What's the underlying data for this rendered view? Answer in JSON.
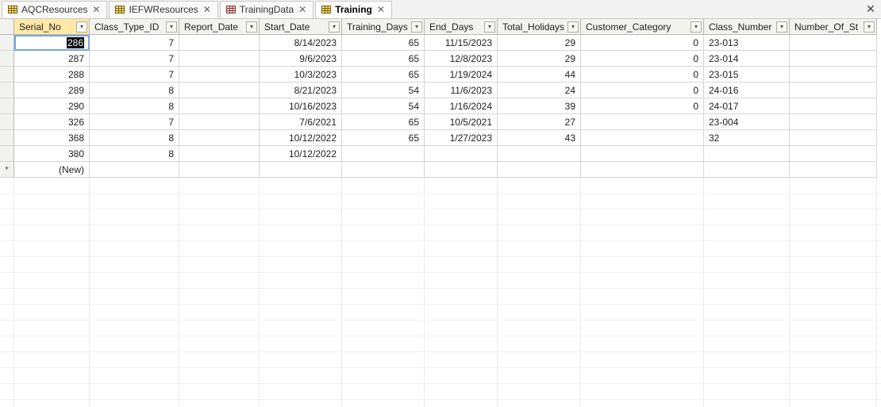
{
  "tabs": [
    {
      "label": "AQCResources",
      "icon": "table",
      "active": false
    },
    {
      "label": "IEFWResources",
      "icon": "table",
      "active": false
    },
    {
      "label": "TrainingData",
      "icon": "form",
      "active": false
    },
    {
      "label": "Training",
      "icon": "table",
      "active": true
    }
  ],
  "columns": [
    "Serial_No",
    "Class_Type_ID",
    "Report_Date",
    "Start_Date",
    "Training_Days",
    "End_Days",
    "Total_Holidays",
    "Customer_Category",
    "Class_Number",
    "Number_Of_St"
  ],
  "rows": [
    {
      "Serial_No": "286",
      "Class_Type_ID": "7",
      "Report_Date": "",
      "Start_Date": "8/14/2023",
      "Training_Days": "65",
      "End_Days": "11/15/2023",
      "Total_Holidays": "29",
      "Customer_Category": "0",
      "Class_Number": "23-013",
      "Number_Of_St": ""
    },
    {
      "Serial_No": "287",
      "Class_Type_ID": "7",
      "Report_Date": "",
      "Start_Date": "9/6/2023",
      "Training_Days": "65",
      "End_Days": "12/8/2023",
      "Total_Holidays": "29",
      "Customer_Category": "0",
      "Class_Number": "23-014",
      "Number_Of_St": ""
    },
    {
      "Serial_No": "288",
      "Class_Type_ID": "7",
      "Report_Date": "",
      "Start_Date": "10/3/2023",
      "Training_Days": "65",
      "End_Days": "1/19/2024",
      "Total_Holidays": "44",
      "Customer_Category": "0",
      "Class_Number": "23-015",
      "Number_Of_St": ""
    },
    {
      "Serial_No": "289",
      "Class_Type_ID": "8",
      "Report_Date": "",
      "Start_Date": "8/21/2023",
      "Training_Days": "54",
      "End_Days": "11/6/2023",
      "Total_Holidays": "24",
      "Customer_Category": "0",
      "Class_Number": "24-016",
      "Number_Of_St": ""
    },
    {
      "Serial_No": "290",
      "Class_Type_ID": "8",
      "Report_Date": "",
      "Start_Date": "10/16/2023",
      "Training_Days": "54",
      "End_Days": "1/16/2024",
      "Total_Holidays": "39",
      "Customer_Category": "0",
      "Class_Number": "24-017",
      "Number_Of_St": ""
    },
    {
      "Serial_No": "326",
      "Class_Type_ID": "7",
      "Report_Date": "",
      "Start_Date": "7/6/2021",
      "Training_Days": "65",
      "End_Days": "10/5/2021",
      "Total_Holidays": "27",
      "Customer_Category": "",
      "Class_Number": "23-004",
      "Number_Of_St": ""
    },
    {
      "Serial_No": "368",
      "Class_Type_ID": "8",
      "Report_Date": "",
      "Start_Date": "10/12/2022",
      "Training_Days": "65",
      "End_Days": "1/27/2023",
      "Total_Holidays": "43",
      "Customer_Category": "",
      "Class_Number": "32",
      "Number_Of_St": ""
    },
    {
      "Serial_No": "380",
      "Class_Type_ID": "8",
      "Report_Date": "",
      "Start_Date": "10/12/2022",
      "Training_Days": "",
      "End_Days": "",
      "Total_Holidays": "",
      "Customer_Category": "",
      "Class_Number": "",
      "Number_Of_St": ""
    }
  ],
  "new_row_label": "(New)",
  "new_row_marker": "*",
  "selected_row_index": 0,
  "cursor_col": "Serial_No",
  "text_columns": [
    "Class_Number"
  ]
}
